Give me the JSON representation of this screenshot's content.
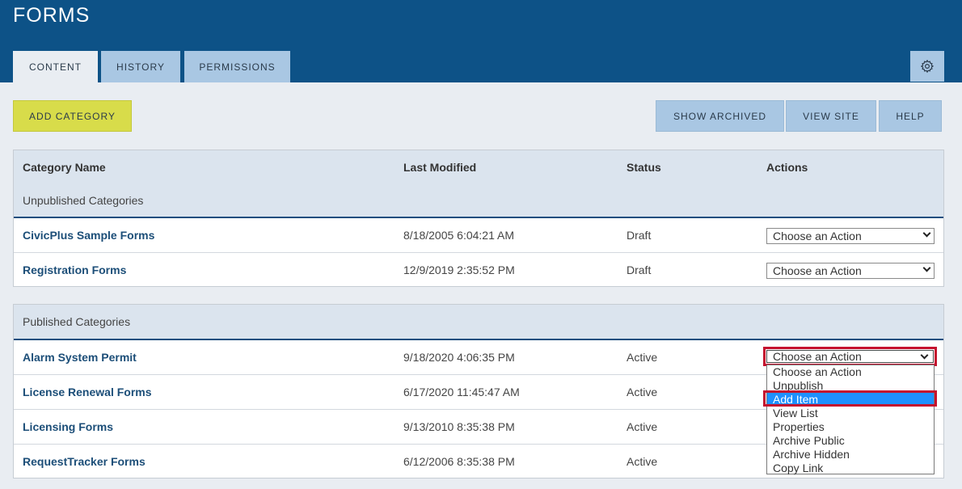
{
  "header": {
    "title": "FORMS"
  },
  "tabs": [
    {
      "label": "CONTENT",
      "active": true
    },
    {
      "label": "HISTORY",
      "active": false
    },
    {
      "label": "PERMISSIONS",
      "active": false
    }
  ],
  "settings_icon": "gear-icon",
  "toolbar": {
    "add_category": "ADD CATEGORY",
    "show_archived": "SHOW ARCHIVED",
    "view_site": "VIEW SITE",
    "help": "HELP"
  },
  "columns": [
    "Category Name",
    "Last Modified",
    "Status",
    "Actions"
  ],
  "unpublished": {
    "label": "Unpublished Categories",
    "rows": [
      {
        "name": "CivicPlus Sample Forms",
        "modified": "8/18/2005 6:04:21 AM",
        "status": "Draft",
        "action": "Choose an Action"
      },
      {
        "name": "Registration Forms",
        "modified": "12/9/2019 2:35:52 PM",
        "status": "Draft",
        "action": "Choose an Action"
      }
    ]
  },
  "published": {
    "label": "Published Categories",
    "rows": [
      {
        "name": "Alarm System Permit",
        "modified": "9/18/2020 4:06:35 PM",
        "status": "Active",
        "action": "Choose an Action"
      },
      {
        "name": "License Renewal Forms",
        "modified": "6/17/2020 11:45:47 AM",
        "status": "Active"
      },
      {
        "name": "Licensing Forms",
        "modified": "9/13/2010 8:35:38 PM",
        "status": "Active"
      },
      {
        "name": "RequestTracker Forms",
        "modified": "6/12/2006 8:35:38 PM",
        "status": "Active"
      }
    ]
  },
  "dropdown": {
    "options": [
      "Choose an Action",
      "Unpublish",
      "Add Item",
      "View List",
      "Properties",
      "Archive Public",
      "Archive Hidden",
      "Copy Link"
    ],
    "selected": "Add Item"
  },
  "colors": {
    "header": "#0d5287",
    "accent_yellow": "#d8dc4a",
    "tab_inactive": "#a9c7e3",
    "highlight": "#c4122f",
    "selected_option": "#1e90ff"
  }
}
